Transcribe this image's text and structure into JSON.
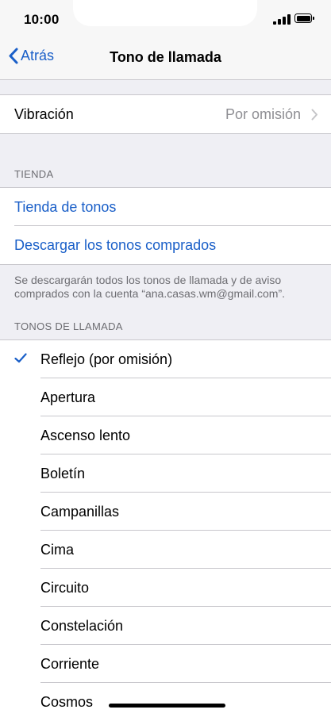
{
  "status": {
    "time": "10:00"
  },
  "nav": {
    "back_label": "Atrás",
    "title": "Tono de llamada"
  },
  "vibration": {
    "label": "Vibración",
    "value": "Por omisión"
  },
  "store": {
    "header": "TIENDA",
    "items": [
      "Tienda de tonos",
      "Descargar los tonos comprados"
    ],
    "footer": "Se descargarán todos los tonos de llamada y de aviso comprados con la cuenta “ana.casas.wm@gmail.com”."
  },
  "ringtones": {
    "header": "TONOS DE LLAMADA",
    "selected_index": 0,
    "items": [
      "Reflejo (por omisión)",
      "Apertura",
      "Ascenso lento",
      "Boletín",
      "Campanillas",
      "Cima",
      "Circuito",
      "Constelación",
      "Corriente",
      "Cosmos"
    ]
  },
  "colors": {
    "accent": "#1a5fc8",
    "background": "#efeff4",
    "secondary_text": "#8e8e93"
  }
}
